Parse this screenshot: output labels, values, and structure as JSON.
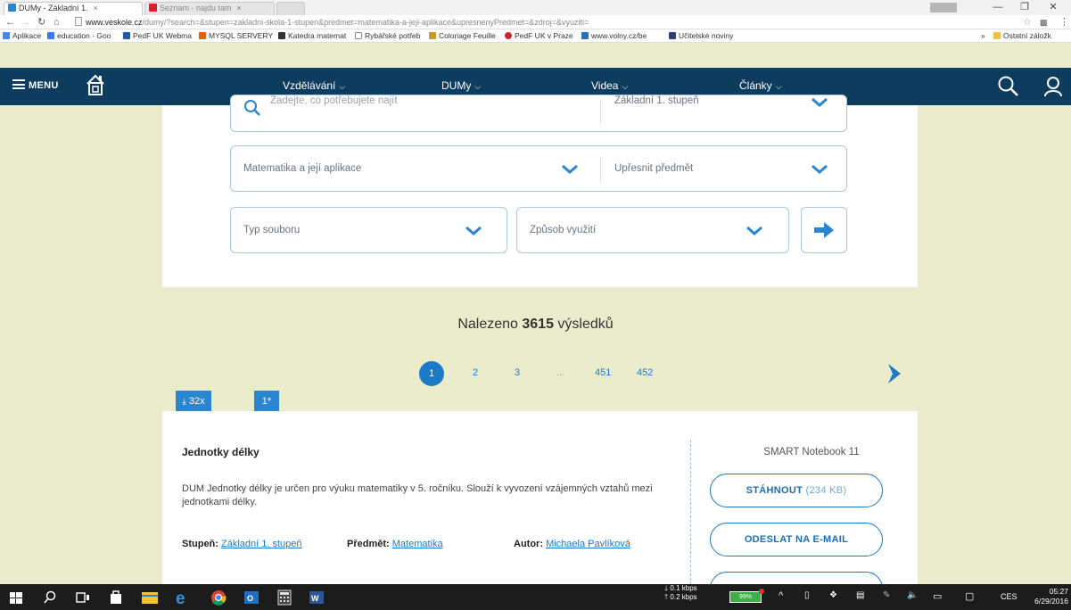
{
  "browser": {
    "tabs": [
      {
        "label": "DUMy - Základní 1.",
        "active": true
      },
      {
        "label": "Seznam - najdu tam",
        "active": false
      }
    ],
    "url_host": "www.veskole.cz",
    "url_path": "/dumy/?search=&stupen=zakladni-skola-1-stupen&predmet=matematika-a-jeji-aplikace&upresnenyPredmet=&zdroj=&vyuziti=",
    "bookmarks": [
      "Aplikace",
      "education - Goo",
      "PedF UK Webma",
      "MYSQL SERVERY",
      "Katedra matemat",
      "Rybářské potřeb",
      "Coloriage Feuille",
      "PedF UK v Praze",
      "www.volny.cz/be",
      "Učitelské noviny"
    ],
    "bookmarks_more": "»",
    "bookmarks_other": "Ostatní záložk"
  },
  "header": {
    "menu_label": "MENU",
    "nav": [
      {
        "label": "Vzdělávání"
      },
      {
        "label": "DUMy"
      },
      {
        "label": "Videa"
      },
      {
        "label": "Články"
      }
    ]
  },
  "filters": {
    "search_placeholder": "Zadejte, co potřebujete najít",
    "stupen": "Základní 1. stupeň",
    "predmet": "Matematika a její aplikace",
    "upresnit": "Upřesnit předmět",
    "typ": "Typ souboru",
    "vyuziti": "Způsob využití"
  },
  "results": {
    "prefix": "Nalezeno",
    "count": "3615",
    "suffix": "výsledků"
  },
  "pagination": {
    "pages": [
      "1",
      "2",
      "3",
      "...",
      "451",
      "452"
    ]
  },
  "card": {
    "downloads": "32x",
    "rating": "1*",
    "title": "Jednotky délky",
    "description": "DUM Jednotky délky je určen pro výuku matematiky v 5. ročníku. Slouží k vyvození vzájemných vztahů mezi jednotkami délky.",
    "stupen_label": "Stupeň:",
    "stupen_value": "Základní 1. stupeň",
    "predmet_label": "Předmět:",
    "predmet_value": "Matematika",
    "autor_label": "Autor:",
    "autor_value": "Michaela Pavlíková",
    "filetype": "SMART Notebook 11",
    "download_label": "STÁHNOUT",
    "download_size": "(234 KB)",
    "email_label": "ODESLAT NA E-MAIL"
  },
  "taskbar": {
    "net_down": "0.1 kbps",
    "net_up": "0.2 kbps",
    "battery": "99%",
    "lang": "CES",
    "time": "05:27",
    "date": "6/29/2016"
  },
  "colors": {
    "header_bg": "#0d3c5e",
    "accent": "#1a7ac6",
    "page_bg": "#ebeccb"
  }
}
